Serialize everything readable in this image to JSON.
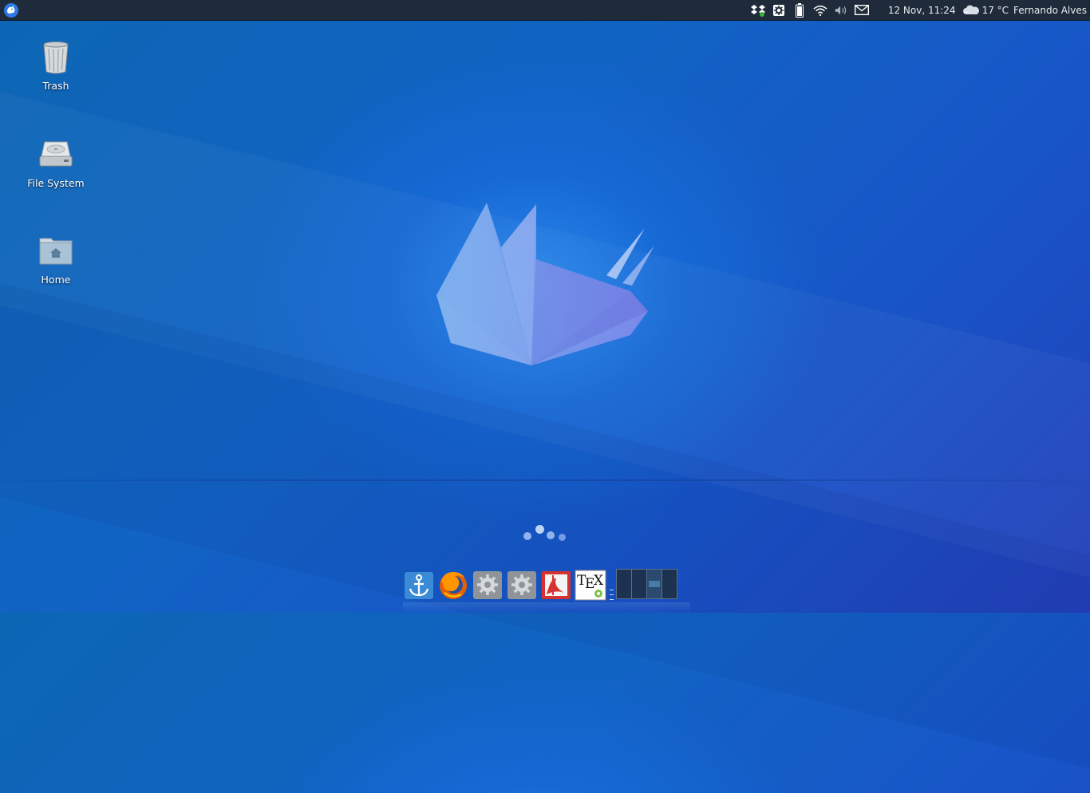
{
  "panel": {
    "clock": "12 Nov, 11:24",
    "weather_temp": "17 °C",
    "user": "Fernando Alves"
  },
  "desktop": {
    "icons": [
      {
        "label": "Trash",
        "icon": "trash-icon"
      },
      {
        "label": "File System",
        "icon": "harddrive-icon"
      },
      {
        "label": "Home",
        "icon": "home-folder-icon"
      }
    ]
  },
  "dock": {
    "items": [
      {
        "icon": "anchor-icon"
      },
      {
        "icon": "firefox-icon"
      },
      {
        "icon": "settings-gear-icon"
      },
      {
        "icon": "settings-gear-icon"
      },
      {
        "icon": "pdf-reader-icon"
      },
      {
        "icon": "tex-icon",
        "label": "TEX"
      }
    ],
    "workspaces": 4,
    "active_workspace": 3
  },
  "colors": {
    "panel_bg": "#1f2b3a",
    "desktop_accent": "#1668d4"
  }
}
